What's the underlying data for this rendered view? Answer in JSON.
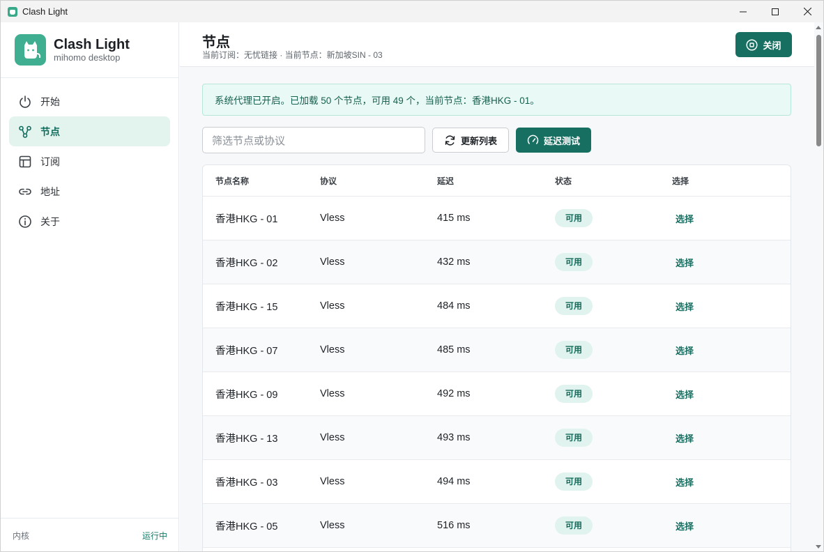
{
  "window": {
    "title": "Clash Light"
  },
  "brand": {
    "name": "Clash Light",
    "subtitle": "mihomo desktop"
  },
  "nav": [
    {
      "label": "开始",
      "icon": "power-icon",
      "active": false
    },
    {
      "label": "节点",
      "icon": "nodes-icon",
      "active": true
    },
    {
      "label": "订阅",
      "icon": "subscription-icon",
      "active": false
    },
    {
      "label": "地址",
      "icon": "link-icon",
      "active": false
    },
    {
      "label": "关于",
      "icon": "info-icon",
      "active": false
    }
  ],
  "footer": {
    "key": "内核",
    "value": "运行中"
  },
  "header": {
    "title": "节点",
    "meta": "当前订阅：无忧链接 · 当前节点：新加坡SIN - 03",
    "close_label": "关闭"
  },
  "alert": {
    "text": "系统代理已开启。已加载 50 个节点，可用 49 个，当前节点：香港HKG - 01。"
  },
  "toolbar": {
    "search_placeholder": "筛选节点或协议",
    "refresh_label": "更新列表",
    "test_label": "延迟测试"
  },
  "table": {
    "columns": [
      "节点名称",
      "协议",
      "延迟",
      "状态",
      "选择"
    ],
    "rows": [
      {
        "name": "香港HKG - 01",
        "protocol": "Vless",
        "latency": "415 ms",
        "status": "可用",
        "action": "选择"
      },
      {
        "name": "香港HKG - 02",
        "protocol": "Vless",
        "latency": "432 ms",
        "status": "可用",
        "action": "选择"
      },
      {
        "name": "香港HKG - 15",
        "protocol": "Vless",
        "latency": "484 ms",
        "status": "可用",
        "action": "选择"
      },
      {
        "name": "香港HKG - 07",
        "protocol": "Vless",
        "latency": "485 ms",
        "status": "可用",
        "action": "选择"
      },
      {
        "name": "香港HKG - 09",
        "protocol": "Vless",
        "latency": "492 ms",
        "status": "可用",
        "action": "选择"
      },
      {
        "name": "香港HKG - 13",
        "protocol": "Vless",
        "latency": "493 ms",
        "status": "可用",
        "action": "选择"
      },
      {
        "name": "香港HKG - 03",
        "protocol": "Vless",
        "latency": "494 ms",
        "status": "可用",
        "action": "选择"
      },
      {
        "name": "香港HKG - 05",
        "protocol": "Vless",
        "latency": "516 ms",
        "status": "可用",
        "action": "选择"
      }
    ]
  },
  "colors": {
    "accent": "#176f61",
    "active_bg": "#e3f3ee",
    "alert_bg": "#e9f9f5"
  }
}
